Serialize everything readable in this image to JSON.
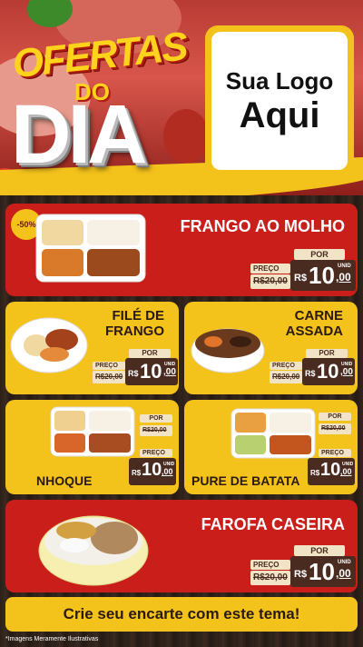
{
  "header": {
    "title_line1": "OFERTAS",
    "title_line2": "DO",
    "title_line3": "DIA",
    "logo_line1": "Sua Logo",
    "logo_line2": "Aqui"
  },
  "colors": {
    "red": "#c91e1a",
    "yellow": "#f3c21b",
    "brown": "#4a2b20",
    "cream": "#f0e3c6"
  },
  "products": [
    {
      "name": "FRANGO AO MOLHO",
      "badge": "-50%",
      "por": "POR",
      "preco": "PREÇO",
      "old": "R$20,00",
      "currency": "R$",
      "int": "10",
      "cents": ",00",
      "unid": "UNID"
    },
    {
      "name_l1": "FILÉ DE",
      "name_l2": "FRANGO",
      "por": "POR",
      "preco": "PREÇO",
      "old": "R$20,00",
      "currency": "R$",
      "int": "10",
      "cents": ",00",
      "unid": "UNID"
    },
    {
      "name_l1": "CARNE",
      "name_l2": "ASSADA",
      "por": "POR",
      "preco": "PREÇO",
      "old": "R$20,00",
      "currency": "R$",
      "int": "10",
      "cents": ",00",
      "unid": "UNID"
    },
    {
      "name": "NHOQUE",
      "por": "POR",
      "preco": "PREÇO",
      "old": "R$20,00",
      "currency": "R$",
      "int": "10",
      "cents": ",00",
      "unid": "UNID"
    },
    {
      "name": "PURE DE BATATA",
      "por": "POR",
      "preco": "PREÇO",
      "old": "R$20,00",
      "currency": "R$",
      "int": "10",
      "cents": ",00",
      "unid": "UNID"
    },
    {
      "name": "FAROFA CASEIRA",
      "por": "POR",
      "preco": "PREÇO",
      "old": "R$20,00",
      "currency": "R$",
      "int": "10",
      "cents": ",00",
      "unid": "UNID"
    }
  ],
  "cta": "Crie seu encarte com este tema!",
  "disclaimer": "*Imagens Meramente Ilustrativas"
}
